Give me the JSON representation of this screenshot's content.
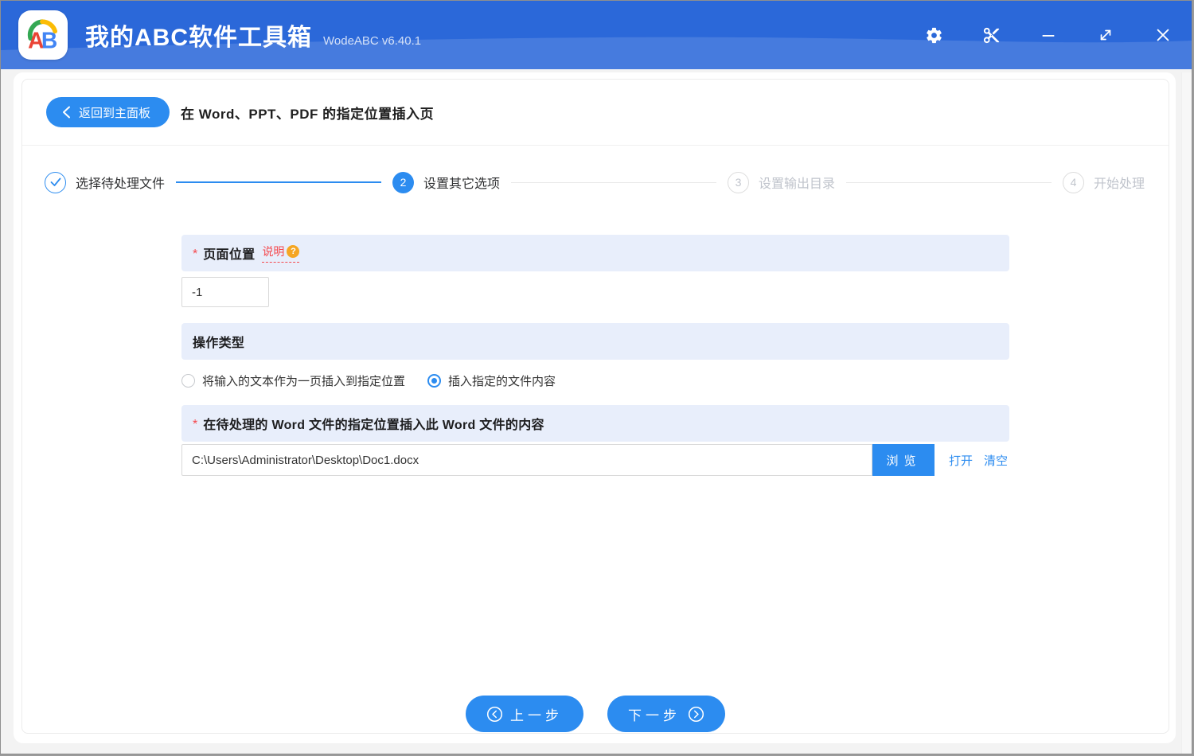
{
  "titlebar": {
    "app_title": "我的ABC软件工具箱",
    "version": "WodeABC v6.40.1",
    "logo_letters": {
      "a": "A",
      "b": "B"
    },
    "icons": [
      "settings-icon",
      "scissors-icon",
      "minimize-icon",
      "maximize-icon",
      "close-icon"
    ]
  },
  "header": {
    "back_label": "返回到主面板",
    "page_title": "在 Word、PPT、PDF 的指定位置插入页"
  },
  "steps": [
    {
      "num": "1",
      "label": "选择待处理文件",
      "state": "done"
    },
    {
      "num": "2",
      "label": "设置其它选项",
      "state": "active"
    },
    {
      "num": "3",
      "label": "设置输出目录",
      "state": "pending"
    },
    {
      "num": "4",
      "label": "开始处理",
      "state": "pending"
    }
  ],
  "form": {
    "page_position": {
      "required_mark": "*",
      "label": "页面位置",
      "help_label": "说明",
      "help_icon": "?",
      "value": "-1"
    },
    "operation_type": {
      "label": "操作类型",
      "options": [
        {
          "label": "将输入的文本作为一页插入到指定位置",
          "selected": false
        },
        {
          "label": "插入指定的文件内容",
          "selected": true
        }
      ]
    },
    "insert_file": {
      "required_mark": "*",
      "label": "在待处理的 Word 文件的指定位置插入此 Word 文件的内容",
      "value": "C:\\Users\\Administrator\\Desktop\\Doc1.docx",
      "browse_label": "浏览",
      "open_label": "打开",
      "clear_label": "清空"
    }
  },
  "footer": {
    "prev_label": "上一步",
    "next_label": "下一步"
  },
  "colors": {
    "primary": "#2c8cf0",
    "titlebar": "#2b68d9",
    "contentBg": "#f3f3f3",
    "sectionBg": "#e8eefb",
    "danger": "#f5484d",
    "warning": "#f5a623"
  }
}
